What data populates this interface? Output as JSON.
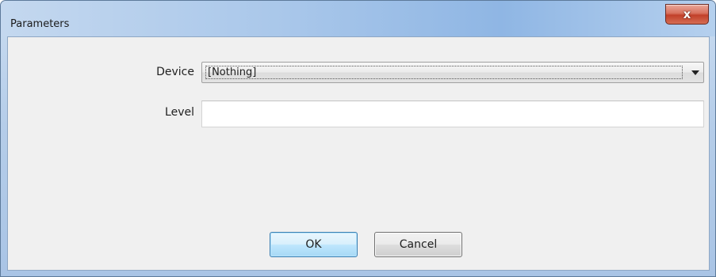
{
  "window": {
    "title": "Parameters",
    "close_icon": "close-icon",
    "close_glyph": "x"
  },
  "form": {
    "device": {
      "label": "Device",
      "selected": "[Nothing]",
      "icon": "chevron-down-icon"
    },
    "level": {
      "label": "Level",
      "value": "",
      "placeholder": ""
    }
  },
  "buttons": {
    "ok_label": "OK",
    "cancel_label": "Cancel"
  },
  "colors": {
    "titlebar": "#a9c7ea",
    "close_button": "#c1402a",
    "client_background": "#f0f0f0",
    "ok_button_border": "#3c7fb1"
  }
}
